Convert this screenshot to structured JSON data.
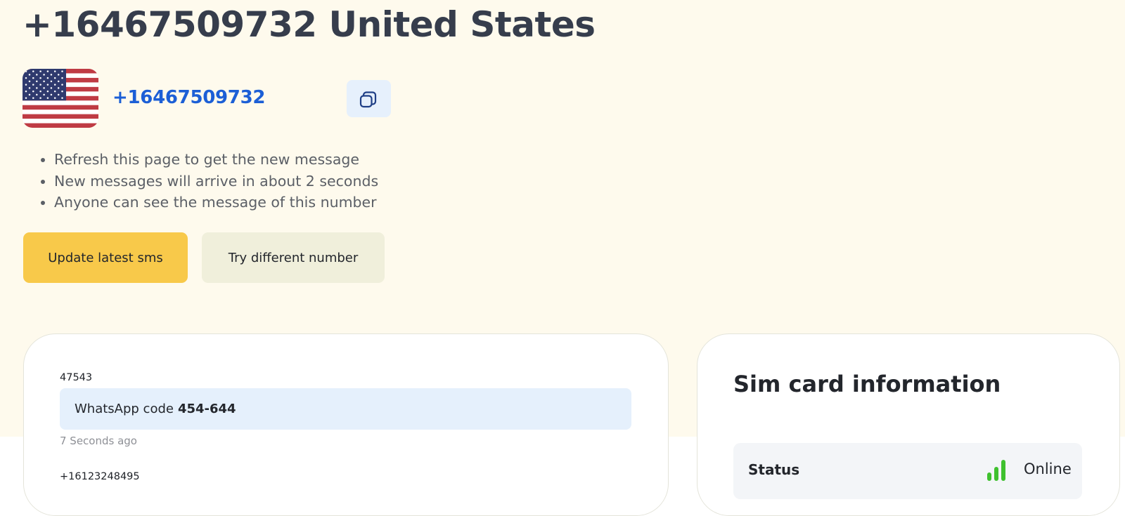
{
  "header": {
    "title": "+16467509732 United States"
  },
  "number_block": {
    "flag_icon": "us-flag-icon",
    "phone_number": "+16467509732",
    "copy_icon": "copy-icon"
  },
  "info_items": [
    "Refresh this page to get the new message",
    "New messages will arrive in about 2 seconds",
    "Anyone can see the message of this number"
  ],
  "buttons": {
    "update_label": "Update latest sms",
    "try_label": "Try different number"
  },
  "messages": [
    {
      "sender": "47543",
      "text": "WhatsApp code",
      "code": "454-644",
      "time": "7 Seconds ago"
    },
    {
      "sender": "+16123248495"
    }
  ],
  "sim_card": {
    "title": "Sim card information",
    "status_label": "Status",
    "status_icon": "signal-bars-icon",
    "status_value": "Online"
  },
  "colors": {
    "page_bg": "#fefaed",
    "accent_blue": "#1c5fd6",
    "update_button": "#f8c94a",
    "try_button": "#f0efdb",
    "message_bubble": "#e5f0fc",
    "signal_green": "#3fc12f"
  }
}
